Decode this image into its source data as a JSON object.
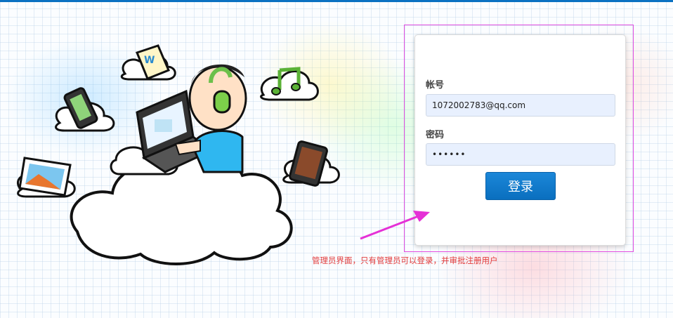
{
  "login": {
    "username_label": "帐号",
    "username_value": "1072002783@qq.com",
    "password_label": "密码",
    "password_value": "••••••",
    "submit_label": "登录"
  },
  "annotation": {
    "note": "管理员界面，只有管理员可以登录，并审批注册用户",
    "frame_color": "#e24ee0",
    "text_color": "#e23b3b"
  },
  "illustration": {
    "icons": [
      "cloud-icon",
      "laptop-icon",
      "headphones-icon",
      "music-note-icon",
      "phone-icon",
      "document-icon",
      "photo-icon",
      "tablet-icon"
    ]
  },
  "colors": {
    "brand_bar": "#0a71c2",
    "button": "#0a6fbf",
    "input_bg": "#e8f0fe"
  }
}
